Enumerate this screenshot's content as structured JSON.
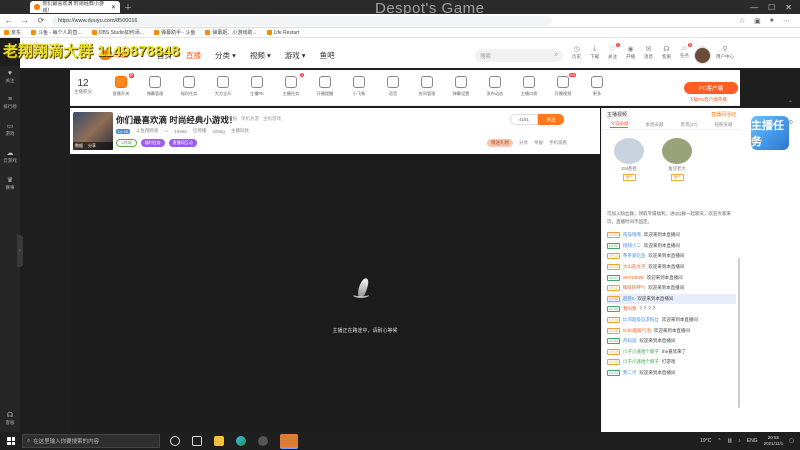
{
  "browser": {
    "tab_title": "你们最喜欢滴 时尚经典小游戏！",
    "url": "https://www.douyu.com/8500016",
    "bookmarks": [
      "京东",
      "斗鱼 - 每个人的直...",
      "OBS Studio如何添...",
      "弹幕助手 - 斗鱼",
      "弹幕姬、小游戏助...",
      "Life Restart"
    ]
  },
  "overlay": {
    "stream_title": "Despot's Game",
    "qq_group": "老翔翔滴大群 1149878848"
  },
  "leftnav": [
    "关注",
    "排行榜",
    "游戏",
    "云游戏",
    "赛事",
    "客服"
  ],
  "header": {
    "logo_text": "斗鱼",
    "nav": [
      "首页",
      "直播",
      "分类 ▾",
      "视频 ▾",
      "游戏 ▾",
      "鱼吧"
    ],
    "search_placeholder": "搜索",
    "icons": [
      {
        "label": "历史",
        "badge": ""
      },
      {
        "label": "下载",
        "badge": ""
      },
      {
        "label": "关注",
        "badge": "1"
      },
      {
        "label": "开播",
        "badge": ""
      },
      {
        "label": "消息",
        "badge": ""
      },
      {
        "label": "客服",
        "badge": ""
      },
      {
        "label": "任务",
        "badge": "5"
      },
      {
        "label": "鱼丸",
        "badge": ""
      },
      {
        "label": "用户中心",
        "badge": ""
      }
    ]
  },
  "catstrip": {
    "rank_num": "12",
    "rank_label": "主播积分",
    "items": [
      {
        "label": "直播开关",
        "badge": "新"
      },
      {
        "label": "弹幕管理",
        "badge": ""
      },
      {
        "label": "福利任务",
        "badge": ""
      },
      {
        "label": "大力全开",
        "badge": ""
      },
      {
        "label": "主播PK",
        "badge": ""
      },
      {
        "label": "主播任务",
        "badge": "3"
      },
      {
        "label": "开播提醒",
        "badge": ""
      },
      {
        "label": "小飞象",
        "badge": ""
      },
      {
        "label": "语音",
        "badge": ""
      },
      {
        "label": "房间管理",
        "badge": ""
      },
      {
        "label": "弹幕设置",
        "badge": ""
      },
      {
        "label": "发布动态",
        "badge": ""
      },
      {
        "label": "主播口袋",
        "badge": ""
      },
      {
        "label": "开播视频",
        "badge": "hot"
      },
      {
        "label": "更多",
        "badge": ""
      }
    ],
    "pc_button": "PC客户端",
    "pc_link": "下载PC客户端开播"
  },
  "room": {
    "title": "你们最喜欢滴 时尚经典小游戏！",
    "tags": [
      "举报",
      "单机热游",
      "主机游戏"
    ],
    "level": "Lv 18",
    "host": "斗鱼翔翔滴",
    "followers": "18586",
    "status": "已停播",
    "hot": "2058g",
    "section": "主播同款",
    "thumb_labels": [
      "数据",
      "分享"
    ],
    "chips": [
      "V领域",
      "福利任务",
      "直播间互动"
    ],
    "follow_count": "4181",
    "follow_label": "关注",
    "actions": [
      "分享",
      "举报",
      "手机观看"
    ],
    "gift_pill": "赠送礼物"
  },
  "video": {
    "offline_msg": "主播正在路途中，请耐心等候"
  },
  "panel": {
    "title": "主播视频",
    "right": "直播间活动",
    "tabs": [
      "今日贡献",
      "本周贡献",
      "贵宾(27)",
      "钻粉贡献"
    ],
    "top_users": [
      {
        "name": "EM爸爸",
        "tag": "用户"
      },
      {
        "name": "鱼仔老大",
        "tag": "用户"
      }
    ],
    "notice": "可加入粉丝群，领取专属福利，进QQ群一起聊天，欢迎大家来玩，直播时间不固定。",
    "chat": [
      {
        "lv": "LV 20",
        "name": "夜猫晓哦",
        "msg": "欢迎来到本直播间",
        "cls": "",
        "hl": false
      },
      {
        "lv": "LV 22",
        "name": "翔翔小二",
        "msg": "欢迎来到本直播间",
        "cls": "",
        "hl": false
      },
      {
        "lv": "LV 13",
        "name": "茶茶爱吃鱼",
        "msg": "欢迎来到本直播间",
        "cls": "",
        "hl": false
      },
      {
        "lv": "LV 15",
        "name": "大山的大子",
        "msg": "欢迎来到本直播间",
        "cls": "o",
        "hl": false
      },
      {
        "lv": "LV 17",
        "name": "w8714828",
        "msg": "欢迎来到本直播间",
        "cls": "o",
        "hl": false
      },
      {
        "lv": "LV 11",
        "name": "咖啡的神气",
        "msg": "欢迎来到本直播间",
        "cls": "o",
        "hl": false
      },
      {
        "lv": "LV 35",
        "name": "超管5",
        "msg": "欢迎来到本直播间",
        "cls": "",
        "hl": true
      },
      {
        "lv": "LV 40",
        "name": "我叫我",
        "msg": "？？？？",
        "cls": "o",
        "hl": false
      },
      {
        "lv": "LV 23",
        "name": "比邻超级追求粉丝",
        "msg": "欢迎来到本直播间",
        "cls": "",
        "hl": false
      },
      {
        "lv": "LV 28",
        "name": "hhhh超级气泡",
        "msg": "欢迎来到本直播间",
        "cls": "o",
        "hl": false
      },
      {
        "lv": "LV 33",
        "name": "月知道",
        "msg": "欢迎来到本直播间",
        "cls": "",
        "hl": false
      },
      {
        "lv": "LV 19",
        "name": "爪子爪速哈个鹅子",
        "msg": "the嘉欣来了",
        "cls": "g",
        "hl": false
      },
      {
        "lv": "LV 20",
        "name": "爪子爪速哈个鹅子",
        "msg": "打游戏",
        "cls": "g",
        "hl": false
      },
      {
        "lv": "LV 21",
        "name": "我二点",
        "msg": "欢迎来到本直播间",
        "cls": "",
        "hl": false
      }
    ]
  },
  "ad": {
    "text": "主播任务"
  },
  "taskbar": {
    "search_placeholder": "在这里输入你要搜索的内容",
    "lang": "ENG",
    "time": "20:55",
    "date": "2021/11/1",
    "temp": "19°C"
  }
}
